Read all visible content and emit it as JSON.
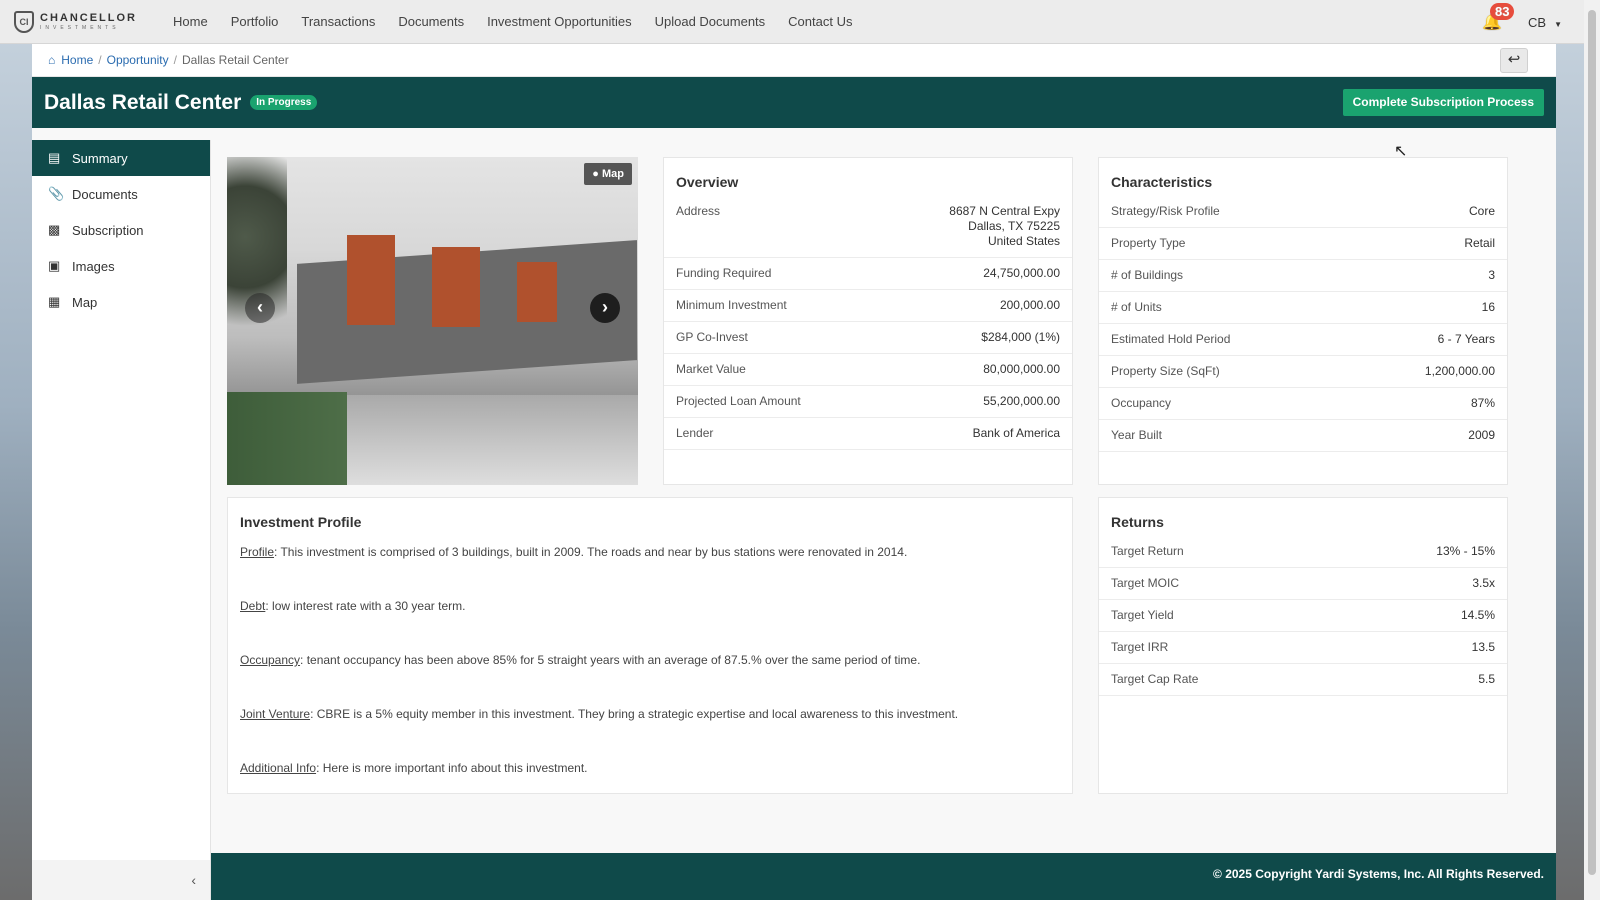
{
  "app": {
    "logo_line1": "CHANCELLOR",
    "logo_line2": "INVESTMENTS"
  },
  "nav": {
    "links": [
      "Home",
      "Portfolio",
      "Transactions",
      "Documents",
      "Investment Opportunities",
      "Upload Documents",
      "Contact Us"
    ],
    "notification_count": "83",
    "user_initials": "CB"
  },
  "breadcrumb": {
    "items": [
      "Home",
      "Opportunity"
    ],
    "current": "Dallas Retail Center"
  },
  "title": {
    "name": "Dallas Retail Center",
    "status": "In Progress",
    "cta": "Complete Subscription Process"
  },
  "sidebar": {
    "items": [
      {
        "label": "Summary",
        "icon": "id-card-icon"
      },
      {
        "label": "Documents",
        "icon": "paperclip-icon"
      },
      {
        "label": "Subscription",
        "icon": "file-icon"
      },
      {
        "label": "Images",
        "icon": "image-icon"
      },
      {
        "label": "Map",
        "icon": "map-icon"
      }
    ]
  },
  "gallery": {
    "map_label": "Map"
  },
  "overview": {
    "title": "Overview",
    "address_label": "Address",
    "address_lines": [
      "8687 N Central Expy",
      "Dallas, TX 75225",
      "United States"
    ],
    "rows": [
      {
        "k": "Funding Required",
        "v": "24,750,000.00"
      },
      {
        "k": "Minimum Investment",
        "v": "200,000.00"
      },
      {
        "k": "GP Co-Invest",
        "v": "$284,000 (1%)"
      },
      {
        "k": "Market Value",
        "v": "80,000,000.00"
      },
      {
        "k": "Projected Loan Amount",
        "v": "55,200,000.00"
      },
      {
        "k": "Lender",
        "v": "Bank of America"
      }
    ]
  },
  "characteristics": {
    "title": "Characteristics",
    "rows": [
      {
        "k": "Strategy/Risk Profile",
        "v": "Core"
      },
      {
        "k": "Property Type",
        "v": "Retail"
      },
      {
        "k": "# of Buildings",
        "v": "3"
      },
      {
        "k": "# of Units",
        "v": "16"
      },
      {
        "k": "Estimated Hold Period",
        "v": "6 - 7 Years"
      },
      {
        "k": "Property Size (SqFt)",
        "v": "1,200,000.00"
      },
      {
        "k": "Occupancy",
        "v": "87%"
      },
      {
        "k": "Year Built",
        "v": "2009"
      }
    ]
  },
  "profile": {
    "title": "Investment Profile",
    "paragraphs": [
      {
        "label": "Profile",
        "text": ": This investment is comprised of 3 buildings, built in 2009. The roads and near by bus stations were renovated in 2014."
      },
      {
        "label": "Debt",
        "text": ": low interest rate with a 30 year term."
      },
      {
        "label": "Occupancy",
        "text": ": tenant occupancy has been above 85% for 5 straight years with an average of 87.5.% over the same period of time."
      },
      {
        "label": "Joint Venture",
        "text": ": CBRE is a 5% equity member in this investment. They bring a strategic expertise and local awareness to this investment."
      },
      {
        "label": "Additional Info",
        "text": ": Here is more important info about this investment."
      }
    ]
  },
  "returns": {
    "title": "Returns",
    "rows": [
      {
        "k": "Target Return",
        "v": "13% - 15%"
      },
      {
        "k": "Target MOIC",
        "v": "3.5x"
      },
      {
        "k": "Target Yield",
        "v": "14.5%"
      },
      {
        "k": "Target IRR",
        "v": "13.5"
      },
      {
        "k": "Target Cap Rate",
        "v": "5.5"
      }
    ]
  },
  "footer": {
    "copyright": "© 2025 Copyright Yardi Systems, Inc. All Rights Reserved."
  },
  "colors": {
    "brand": "#0f4a4a",
    "accent": "#1aa36f",
    "link": "#2b6cb0",
    "badge": "#e74c3c"
  }
}
